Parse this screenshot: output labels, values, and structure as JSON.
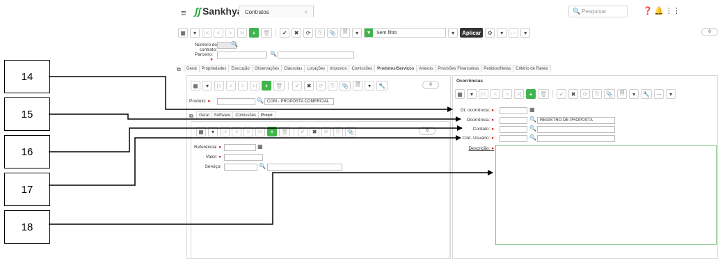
{
  "callouts": [
    "14",
    "15",
    "16",
    "17",
    "18"
  ],
  "header": {
    "logo": "Sankhya",
    "tab": "Contratos",
    "tab_close": "×",
    "search_placeholder": "Pesquisar",
    "menu_icon": "≡"
  },
  "toolbar": {
    "filter_label": "Sem filtro",
    "apply_label": "Aplicar",
    "more": "···",
    "toggle": "0"
  },
  "contract": {
    "numero_label": "Número do contrato:",
    "parceiro_label": "Parceiro:"
  },
  "main_tabs": [
    "Geral",
    "Propriedades",
    "Execução",
    "Observações",
    "Cláusulas",
    "Locações",
    "Impostos",
    "Comissões",
    "Produtos/Serviços",
    "Anexos",
    "Provisões Financeiras",
    "Pedidos/Notas",
    "Critério de Rateio"
  ],
  "produtos": {
    "produto_label": "Produto:",
    "produto_desc": "COM - PROPOSTA COMERCIAL",
    "sub_tabs": [
      "Geral",
      "Software",
      "Comissões",
      "Preço"
    ],
    "referencia_label": "Referência:",
    "valor_label": "Valor:",
    "servico_label": "Serviço:"
  },
  "ocorrencias": {
    "title": "Ocorrências",
    "dt_label": "Dt. ocorrência:",
    "ocorrencia_label": "Ocorrência:",
    "ocorrencia_desc": "REGISTRO DE PROPOSTA",
    "contato_label": "Contato:",
    "usuario_label": "Cód. Usuário:",
    "descricao_label": "Descrição:"
  }
}
